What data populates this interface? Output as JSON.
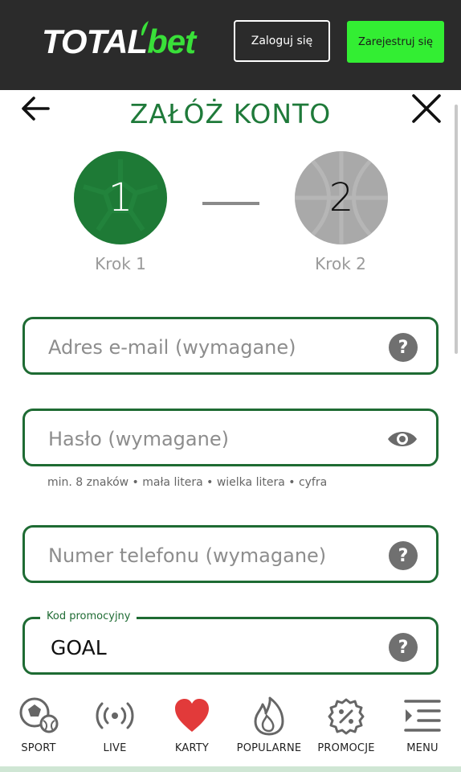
{
  "header": {
    "logo_total": "TOTAL",
    "logo_bet": "bet",
    "login_label": "Zaloguj się",
    "register_label": "Zarejestruj się"
  },
  "page": {
    "title": "ZAŁÓŻ KONTO"
  },
  "steps": [
    {
      "number": "1",
      "label": "Krok 1",
      "active": true
    },
    {
      "number": "2",
      "label": "Krok 2",
      "active": false
    }
  ],
  "form": {
    "email_placeholder": "Adres e-mail (wymagane)",
    "password_placeholder": "Hasło (wymagane)",
    "password_hint": "min. 8 znaków • mała litera • wielka litera • cyfra",
    "phone_placeholder": "Numer telefonu (wymagane)",
    "promo_label": "Kod promocyjny",
    "promo_value": "GOAL"
  },
  "nav": [
    {
      "label": "SPORT",
      "icon": "sport-ball-icon"
    },
    {
      "label": "LIVE",
      "icon": "live-broadcast-icon"
    },
    {
      "label": "KARTY",
      "icon": "heart-icon"
    },
    {
      "label": "POPULARNE",
      "icon": "flame-icon"
    },
    {
      "label": "PROMOCJE",
      "icon": "promo-percent-icon"
    },
    {
      "label": "MENU",
      "icon": "menu-icon"
    }
  ],
  "colors": {
    "header_bg": "#2b2b2b",
    "brand_green": "#33ee33",
    "form_green": "#1e6b33",
    "step_active": "#1e7a36",
    "step_inactive": "#a9a9a9",
    "heart_red": "#e23a3a"
  }
}
